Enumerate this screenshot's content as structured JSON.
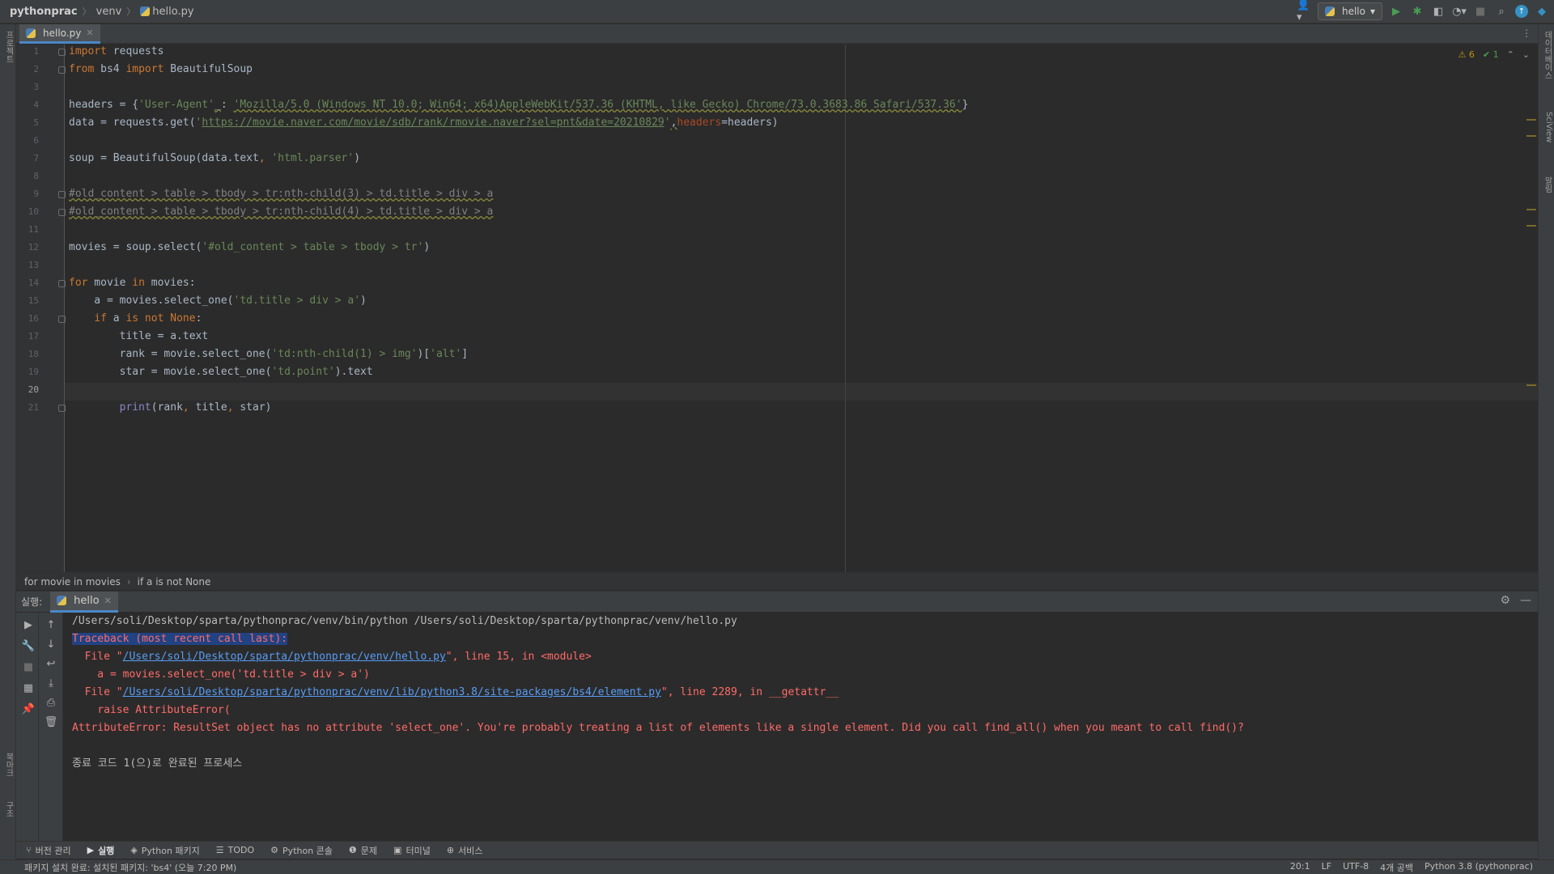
{
  "titlebar": {
    "project": "pythonprac",
    "folder": "venv",
    "file": "hello.py",
    "run_config": "hello"
  },
  "editor_tab": {
    "label": "hello.py"
  },
  "inspections": {
    "warnings": "6",
    "ok": "1"
  },
  "code_lines": [
    {
      "n": "1",
      "html": "<span class=\"k\">import</span> requests"
    },
    {
      "n": "2",
      "html": "<span class=\"k\">from</span> bs4 <span class=\"k\">import</span> BeautifulSoup"
    },
    {
      "n": "3",
      "html": ""
    },
    {
      "n": "4",
      "html": "headers = {<span class=\"s\">'User-Agent'</span><span class=\"wv\">_</span>: <span class=\"s wv\">'Mozilla/5.0 (Windows NT 10.0; Win64; x64)AppleWebKit/537.36 (KHTML, like Gecko) Chrome/73.0.3683.86 Safari/537.36'</span>}"
    },
    {
      "n": "5",
      "html": "data = requests.get(<span class=\"s\">'<span class=\"u\">https://movie.naver.com/movie/sdb/rank/rmovie.naver?sel=pnt&amp;date=20210829</span>'</span><span class=\"wv\">,</span><span class=\"pm\">headers</span>=headers)"
    },
    {
      "n": "6",
      "html": ""
    },
    {
      "n": "7",
      "html": "soup = BeautifulSoup(data.text<span class=\"k\">,</span> <span class=\"s\">'html.parser'</span>)"
    },
    {
      "n": "8",
      "html": ""
    },
    {
      "n": "9",
      "html": "<span class=\"cm\">#old_content &gt; table &gt; tbody &gt; tr:nth-child(3) &gt; td.title &gt; div &gt; a</span>"
    },
    {
      "n": "10",
      "html": "<span class=\"cm\">#old_content &gt; table &gt; tbody &gt; tr:nth-child(4) &gt; td.title &gt; div &gt; a</span>"
    },
    {
      "n": "11",
      "html": ""
    },
    {
      "n": "12",
      "html": "movies = soup.select(<span class=\"s\">'#old_content &gt; table &gt; tbody &gt; tr'</span>)"
    },
    {
      "n": "13",
      "html": ""
    },
    {
      "n": "14",
      "html": "<span class=\"k\">for</span> movie <span class=\"k\">in</span> movies:"
    },
    {
      "n": "15",
      "html": "    a = movies.select_one(<span class=\"s\">'td.title &gt; div &gt; a'</span>)"
    },
    {
      "n": "16",
      "html": "    <span class=\"k\">if</span> a <span class=\"k\">is not</span> <span class=\"k\">None</span>:"
    },
    {
      "n": "17",
      "html": "        title = a.text"
    },
    {
      "n": "18",
      "html": "        rank = movie.select_one(<span class=\"s\">'td:nth-child(1) &gt; img'</span>)[<span class=\"s\">'alt'</span>]"
    },
    {
      "n": "19",
      "html": "        star = movie.select_one(<span class=\"s\">'td.point'</span>).text"
    },
    {
      "n": "20",
      "html": ""
    },
    {
      "n": "21",
      "html": "        <span class=\"b\">print</span>(rank<span class=\"k\">,</span> title<span class=\"k\">,</span> star)"
    }
  ],
  "breadcrumb": {
    "item1": "for movie in movies",
    "item2": "if a is not None"
  },
  "run_panel": {
    "label": "실행:",
    "tab": "hello"
  },
  "console_lines": [
    {
      "cls": "",
      "html": "/Users/soli/Desktop/sparta/pythonprac/venv/bin/python /Users/soli/Desktop/sparta/pythonprac/venv/hello.py"
    },
    {
      "cls": "err",
      "html": "<span class=\"hl\">Traceback (most recent call last):</span>"
    },
    {
      "cls": "err",
      "html": "  File \"<span class=\"link\">/Users/soli/Desktop/sparta/pythonprac/venv/hello.py</span>\", line 15, in &lt;module&gt;"
    },
    {
      "cls": "err",
      "html": "    a = movies.select_one('td.title &gt; div &gt; a')"
    },
    {
      "cls": "err",
      "html": "  File \"<span class=\"link\">/Users/soli/Desktop/sparta/pythonprac/venv/lib/python3.8/site-packages/bs4/element.py</span>\", line 2289, in __getattr__"
    },
    {
      "cls": "err",
      "html": "    raise AttributeError("
    },
    {
      "cls": "err",
      "html": "AttributeError: ResultSet object has no attribute 'select_one'. You're probably treating a list of elements like a single element. Did you call find_all() when you meant to call find()?"
    },
    {
      "cls": "",
      "html": ""
    },
    {
      "cls": "",
      "html": "종료 코드 1(으)로 완료된 프로세스"
    }
  ],
  "bottom_tools": [
    {
      "label": "버전 관리",
      "icon": "branch-icon",
      "glyph": "⑂",
      "active": false
    },
    {
      "label": "실행",
      "icon": "run-icon",
      "glyph": "▶",
      "active": true
    },
    {
      "label": "Python 패키지",
      "icon": "package-icon",
      "glyph": "◈",
      "active": false
    },
    {
      "label": "TODO",
      "icon": "todo-icon",
      "glyph": "☰",
      "active": false
    },
    {
      "label": "Python 콘솔",
      "icon": "python-console-icon",
      "glyph": "⚙",
      "active": false
    },
    {
      "label": "문제",
      "icon": "problems-icon",
      "glyph": "❶",
      "active": false
    },
    {
      "label": "터미널",
      "icon": "terminal-icon",
      "glyph": "▣",
      "active": false
    },
    {
      "label": "서비스",
      "icon": "services-icon",
      "glyph": "⊕",
      "active": false
    }
  ],
  "left_strip": {
    "top_label": "프로젝트",
    "mid_label": "북마크",
    "bottom_label": "구조"
  },
  "right_strip": {
    "label1": "데이터베이스",
    "label2": "SciView",
    "label3": "알림"
  },
  "statusbar": {
    "message": "패키지 설치 완료: 설치된 패키지: 'bs4' (오늘 7:20 PM)",
    "position": "20:1",
    "line_sep": "LF",
    "encoding": "UTF-8",
    "indent": "4개 공백",
    "interpreter": "Python 3.8 (pythonprac)"
  },
  "colors": {
    "keyword": "#cc7832",
    "string": "#6a8759",
    "error": "#ff6b68",
    "link": "#589df6",
    "accent": "#4a88c7"
  }
}
